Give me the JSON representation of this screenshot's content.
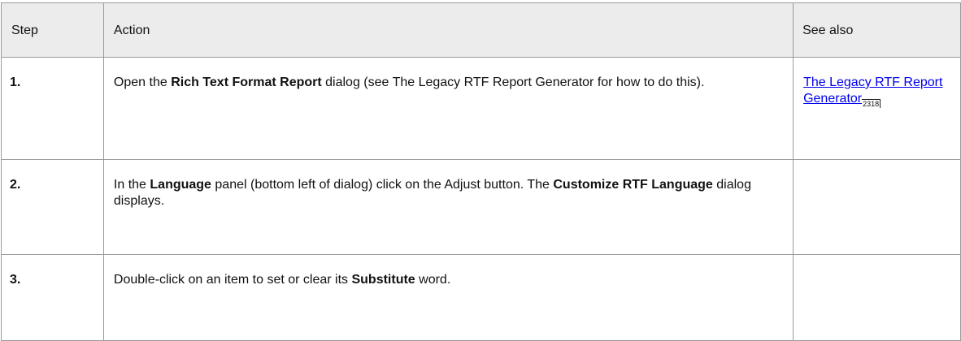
{
  "table": {
    "headers": {
      "step": "Step",
      "action": "Action",
      "see_also": "See also"
    },
    "rows": [
      {
        "step": "1.",
        "action_parts": [
          "Open the ",
          "Rich Text Format Report",
          " dialog (see The Legacy RTF Report Generator for how to do this)."
        ],
        "see_also": {
          "link": "The Legacy RTF Report Generator",
          "ref": "2318"
        }
      },
      {
        "step": "2.",
        "action_parts": [
          "In the ",
          "Language",
          " panel (bottom left of dialog) click on the Adjust button. The ",
          "Customize RTF Language",
          " dialog displays."
        ]
      },
      {
        "step": "3.",
        "action_parts": [
          "Double-click on an item to set or clear its ",
          "Substitute",
          " word."
        ]
      }
    ]
  }
}
